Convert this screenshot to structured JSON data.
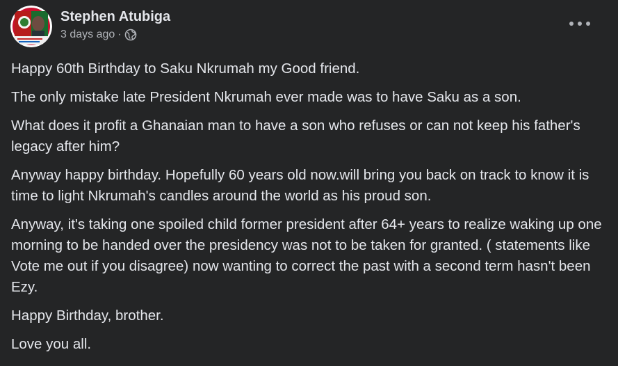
{
  "post": {
    "author": "Stephen Atubiga",
    "timestamp": "3 days ago",
    "separator": "·",
    "privacy_icon": "globe-icon",
    "more_icon": "more-options-icon",
    "paragraphs": [
      "Happy  60th Birthday to Saku Nkrumah my Good friend.",
      "The only mistake late President Nkrumah ever made was to have Saku as a son.",
      "What does it profit a Ghanaian man to have a son who refuses or can not keep his father's legacy after him?",
      "Anyway happy birthday. Hopefully 60 years old now.will bring you back on track to know it is time to light Nkrumah's candles around the world as his proud son.",
      "Anyway, it's taking one spoiled child former president after 64+ years to realize waking up one morning to be handed over the presidency was not to be taken for granted. ( statements like Vote me out if you disagree) now wanting to correct the past with a second term hasn't been Ezy.",
      "Happy Birthday, brother.",
      "Love you all."
    ]
  },
  "colors": {
    "background": "#242526",
    "primary_text": "#e4e6eb",
    "secondary_text": "#b0b3b8"
  }
}
